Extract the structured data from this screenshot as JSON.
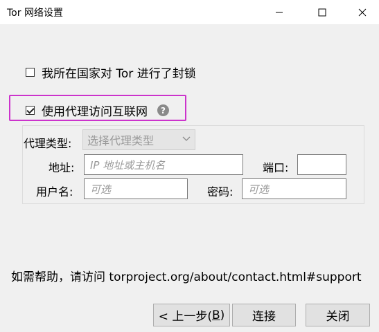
{
  "window": {
    "title": "Tor 网络设置"
  },
  "options": {
    "blocked_label": "我所在国家对 Tor 进行了封锁",
    "blocked_checked": false,
    "proxy_label": "使用代理访问互联网",
    "proxy_checked": true,
    "help_glyph": "?"
  },
  "proxy": {
    "type_label": "代理类型:",
    "type_value": "选择代理类型",
    "address_label": "地址:",
    "address_placeholder": "IP 地址或主机名",
    "port_label": "端口:",
    "port_value": "",
    "username_label": "用户名:",
    "username_placeholder": "可选",
    "password_label": "密码:",
    "password_placeholder": "可选"
  },
  "help": {
    "text": "如需帮助，请访问 torproject.org/about/contact.html#support"
  },
  "buttons": {
    "back_prefix": "< 上一步(",
    "back_key": "B",
    "back_suffix": ")",
    "connect": "连接",
    "close": "关闭"
  },
  "icons": {
    "minimize": "minimize-icon",
    "maximize": "maximize-icon",
    "close": "close-icon",
    "help": "help-icon",
    "dropdown": "chevron-down-icon"
  },
  "colors": {
    "highlight": "#cc33cc",
    "background": "#f0f0f0"
  }
}
